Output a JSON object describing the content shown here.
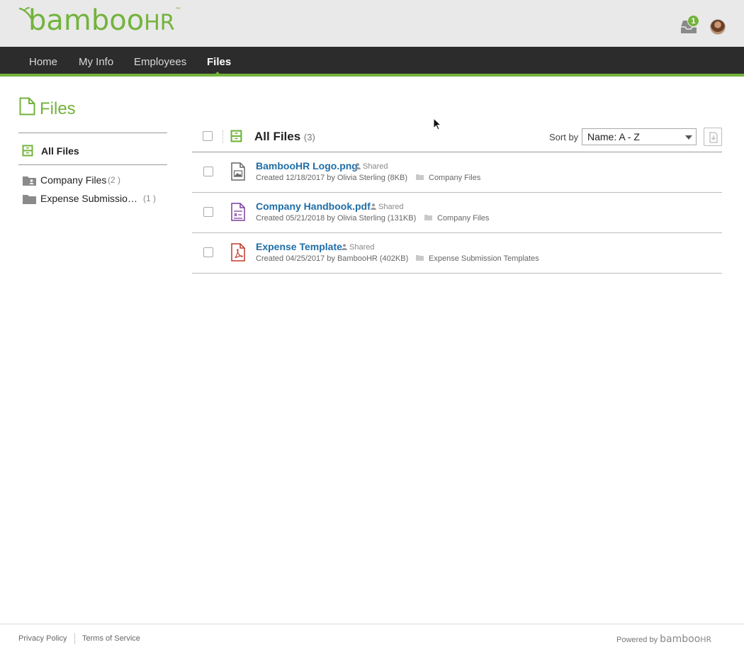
{
  "header": {
    "logo_text": "bamboo",
    "logo_hr": "HR",
    "logo_tm": "™",
    "inbox_badge": "1",
    "icons": {
      "inbox": "inbox-icon",
      "avatar": "user-avatar"
    }
  },
  "nav": {
    "items": [
      {
        "label": "Home"
      },
      {
        "label": "My Info"
      },
      {
        "label": "Employees"
      },
      {
        "label": "Files",
        "active": true
      }
    ]
  },
  "page": {
    "title": "Files"
  },
  "sidebar": {
    "all_files_label": "All Files",
    "folders": [
      {
        "label": "Company Files",
        "count": "(2 )"
      },
      {
        "label": "Expense Submissio…",
        "count": "(1 )"
      }
    ]
  },
  "list": {
    "title": "All Files",
    "count": "(3)",
    "sort_label": "Sort by",
    "sort_value": "Name: A - Z",
    "files": [
      {
        "name": "BambooHR Logo.png",
        "shared": "Shared",
        "meta": "Created 12/18/2017 by Olivia Sterling (8KB)",
        "folder": "Company Files",
        "icon": "image-file-icon"
      },
      {
        "name": "Company Handbook.pdf",
        "shared": "Shared",
        "meta": "Created 05/21/2018 by Olivia Sterling (131KB)",
        "folder": "Company Files",
        "icon": "document-file-icon"
      },
      {
        "name": "Expense Template",
        "shared": "Shared",
        "meta": "Created 04/25/2017 by BambooHR (402KB)",
        "folder": "Expense Submission Templates",
        "icon": "pdf-file-icon"
      }
    ]
  },
  "footer": {
    "privacy": "Privacy Policy",
    "terms": "Terms of Service",
    "powered_by": "Powered by",
    "powered_logo": "bamboo",
    "powered_logo_hr": "HR"
  },
  "colors": {
    "brand_green": "#73b33c",
    "nav_dark": "#2c2c2c",
    "link_blue": "#1f6ea8",
    "pdf_red": "#c0392b",
    "doc_purple": "#7b3f9e"
  }
}
